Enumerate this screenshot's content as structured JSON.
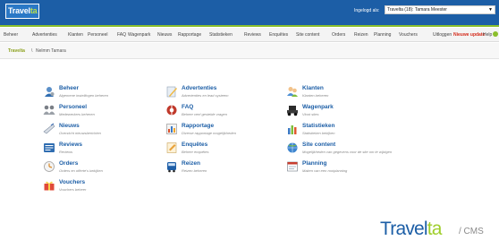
{
  "header": {
    "logo_text": "Travel",
    "logo_accent": "ta",
    "login_label": "Ingelogd als:",
    "user_selected": "Travelta (18): Tamara Meester"
  },
  "nav": {
    "items": [
      "Beheer",
      "Advertenties",
      "Klanten",
      "Personeel",
      "FAQ",
      "Wagenpark",
      "Nieuws",
      "Rapportage",
      "Statistieken",
      "Reviews",
      "Enquêtes",
      "Site content",
      "Orders",
      "Reizen",
      "Planning",
      "Vouchers"
    ],
    "logout": "Uitloggen",
    "update": "Nieuwe update",
    "help": "Help"
  },
  "breadcrumb": {
    "root": "Travelta",
    "separator": "\\",
    "current": "Nelmm Tamara"
  },
  "dashboard": [
    {
      "title": "Beheer",
      "desc": "Algemene instellingen beheren",
      "icon": "settings-person-icon"
    },
    {
      "title": "Advertenties",
      "desc": "Advertenties en lead systeem",
      "icon": "pencil-icon"
    },
    {
      "title": "Klanten",
      "desc": "Klanten beheren",
      "icon": "customers-icon"
    },
    {
      "title": "Personeel",
      "desc": "Medewerkers beheren",
      "icon": "staff-icon"
    },
    {
      "title": "FAQ",
      "desc": "Beheer veel gestelde vragen",
      "icon": "faq-icon"
    },
    {
      "title": "Wagenpark",
      "desc": "Vloot sites",
      "icon": "car-icon"
    },
    {
      "title": "Nieuws",
      "desc": "Overzicht nieuwsberichten",
      "icon": "news-icon"
    },
    {
      "title": "Rapportage",
      "desc": "Diverse rapportage mogelijkheden",
      "icon": "report-icon"
    },
    {
      "title": "Statistieken",
      "desc": "Statistieken bekijken",
      "icon": "statistics-icon"
    },
    {
      "title": "Reviews",
      "desc": "Reviews",
      "icon": "reviews-icon"
    },
    {
      "title": "Enquêtes",
      "desc": "Beheer enquêtes",
      "icon": "survey-icon"
    },
    {
      "title": "Site content",
      "desc": "Mogelijkheden van gegevens voor de site om te wijzigen",
      "icon": "site-content-icon"
    },
    {
      "title": "Orders",
      "desc": "Orders en offerte's bekijken",
      "icon": "orders-icon"
    },
    {
      "title": "Reizen",
      "desc": "Reizen beheren",
      "icon": "bus-icon"
    },
    {
      "title": "Planning",
      "desc": "Maken van een rooiplanning",
      "icon": "planning-icon"
    },
    {
      "title": "Vouchers",
      "desc": "Vouchers beheer",
      "icon": "voucher-icon"
    }
  ],
  "footer_brand": {
    "main": "Travel",
    "accent": "ta",
    "sub": "/ CMS"
  },
  "colors": {
    "primary_blue": "#1c5ea6",
    "accent_green": "#8bbf2c",
    "update_red": "#d42a1a"
  }
}
